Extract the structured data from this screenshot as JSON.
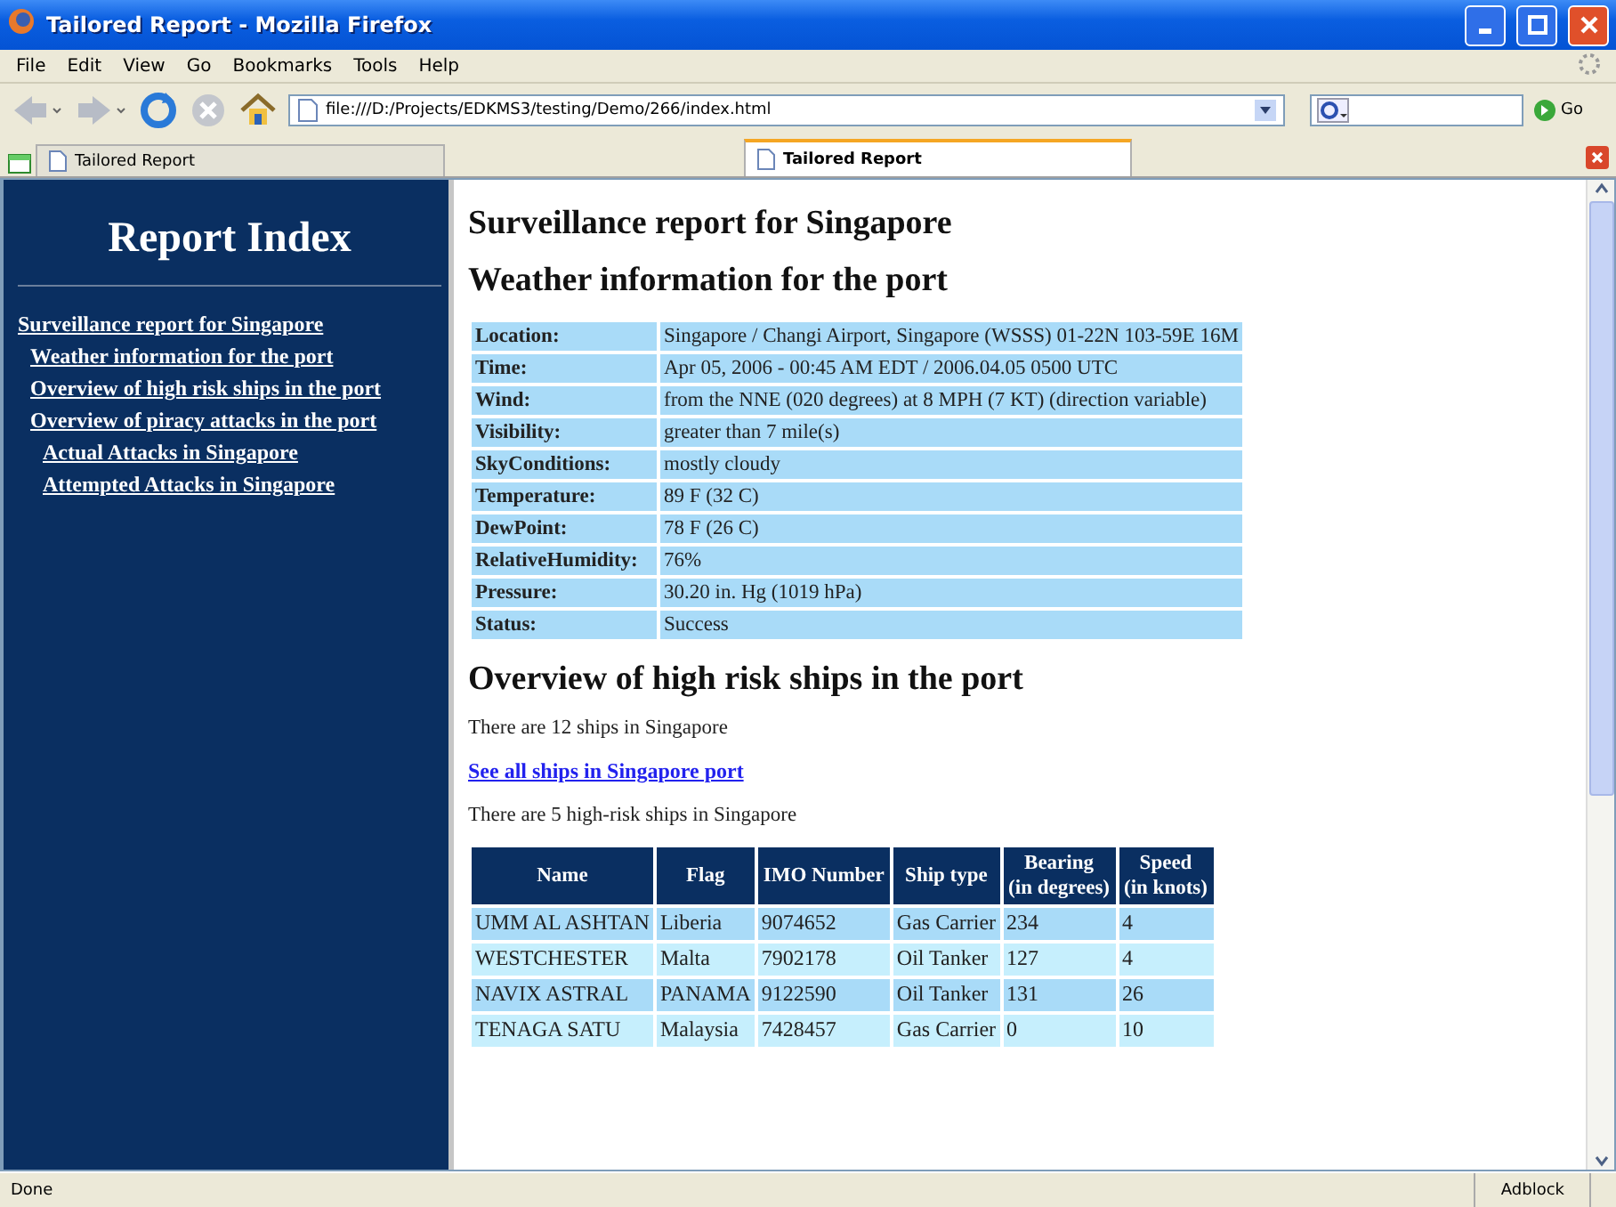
{
  "window": {
    "title": "Tailored Report - Mozilla Firefox"
  },
  "menu": [
    "File",
    "Edit",
    "View",
    "Go",
    "Bookmarks",
    "Tools",
    "Help"
  ],
  "toolbar": {
    "address": "file:///D:/Projects/EDKMS3/testing/Demo/266/index.html",
    "go_label": "Go"
  },
  "tabs": [
    {
      "label": "Tailored Report",
      "selected": false
    },
    {
      "label": "Tailored Report",
      "selected": true
    }
  ],
  "sidebar": {
    "title": "Report Index",
    "items": [
      {
        "label": "Surveillance report for Singapore",
        "children": [
          {
            "label": "Weather information for the port"
          },
          {
            "label": "Overview of high risk ships in the port"
          },
          {
            "label": "Overview of piracy attacks in the port",
            "children": [
              {
                "label": "Actual Attacks in Singapore"
              },
              {
                "label": "Attempted Attacks in Singapore"
              }
            ]
          }
        ]
      }
    ]
  },
  "report": {
    "title": "Surveillance report for Singapore",
    "weather": {
      "heading": "Weather information for the port",
      "rows": [
        {
          "label": "Location:",
          "value": "Singapore / Changi Airport, Singapore (WSSS) 01-22N 103-59E 16M"
        },
        {
          "label": "Time:",
          "value": "Apr 05, 2006 - 00:45 AM EDT / 2006.04.05 0500 UTC"
        },
        {
          "label": "Wind:",
          "value": "from the NNE (020 degrees) at 8 MPH (7 KT) (direction variable)"
        },
        {
          "label": "Visibility:",
          "value": "greater than 7 mile(s)"
        },
        {
          "label": "SkyConditions:",
          "value": "mostly cloudy"
        },
        {
          "label": "Temperature:",
          "value": "89 F (32 C)"
        },
        {
          "label": "DewPoint:",
          "value": "78 F (26 C)"
        },
        {
          "label": "RelativeHumidity:",
          "value": "76%"
        },
        {
          "label": "Pressure:",
          "value": "30.20 in. Hg (1019 hPa)"
        },
        {
          "label": "Status:",
          "value": "Success"
        }
      ]
    },
    "ships": {
      "heading": "Overview of high risk ships in the port",
      "count_text": "There are 12 ships in Singapore",
      "link": "See all ships in Singapore port",
      "risk_text": "There are 5 high-risk ships in Singapore",
      "columns": [
        "Name",
        "Flag",
        "IMO Number",
        "Ship type",
        "Bearing (in degrees)",
        "Speed (in knots)"
      ],
      "rows": [
        [
          "UMM AL ASHTAN",
          "Liberia",
          "9074652",
          "Gas Carrier",
          "234",
          "4"
        ],
        [
          "WESTCHESTER",
          "Malta",
          "7902178",
          "Oil Tanker",
          "127",
          "4"
        ],
        [
          "NAVIX ASTRAL",
          "PANAMA",
          "9122590",
          "Oil Tanker",
          "131",
          "26"
        ],
        [
          "TENAGA SATU",
          "Malaysia",
          "7428457",
          "Gas Carrier",
          "0",
          "10"
        ]
      ]
    }
  },
  "status_bar": {
    "text": "Done",
    "addon": "Adblock"
  }
}
